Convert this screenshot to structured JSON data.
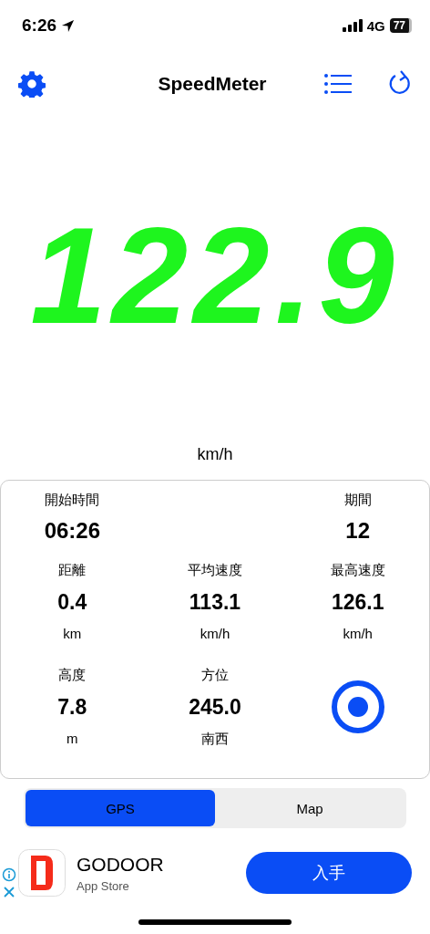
{
  "status_bar": {
    "time": "6:26",
    "network": "4G",
    "battery": "77"
  },
  "header": {
    "title": "SpeedMeter"
  },
  "speed": {
    "value": "122.9",
    "unit": "km/h"
  },
  "stats_top": [
    {
      "label": "開始時間",
      "value": "06:26"
    },
    {
      "label": "期間",
      "value": "12"
    }
  ],
  "stats": [
    {
      "label": "距離",
      "value": "0.4",
      "unit": "km"
    },
    {
      "label": "平均速度",
      "value": "113.1",
      "unit": "km/h"
    },
    {
      "label": "最高速度",
      "value": "126.1",
      "unit": "km/h"
    },
    {
      "label": "高度",
      "value": "7.8",
      "unit": "m"
    },
    {
      "label": "方位",
      "value": "245.0",
      "unit": "南西"
    }
  ],
  "segments": [
    {
      "label": "GPS",
      "selected": true
    },
    {
      "label": "Map",
      "selected": false
    }
  ],
  "ad": {
    "name": "GODOOR",
    "source": "App Store",
    "button": "入手"
  }
}
